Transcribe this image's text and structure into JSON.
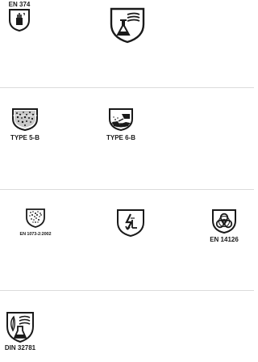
{
  "rows": [
    {
      "items": [
        {
          "label": "EN 374",
          "icon": "chemical-glove-shield-icon"
        },
        {
          "label": "",
          "icon": "chemical-flask-shield-icon"
        }
      ]
    },
    {
      "items": [
        {
          "label": "TYPE 5-B",
          "icon": "particle-protection-shield-icon"
        },
        {
          "label": "TYPE 6-B",
          "icon": "liquid-splash-shield-icon"
        }
      ]
    },
    {
      "items": [
        {
          "label": "EN 1073-2:2002",
          "icon": "radioactive-particle-shield-icon"
        },
        {
          "label": "",
          "icon": "electrostatic-shield-icon"
        },
        {
          "label": "EN 14126",
          "icon": "biohazard-shield-icon"
        }
      ]
    },
    {
      "items": [
        {
          "label": "DIN 32781",
          "icon": "pesticide-shield-icon"
        }
      ]
    }
  ]
}
